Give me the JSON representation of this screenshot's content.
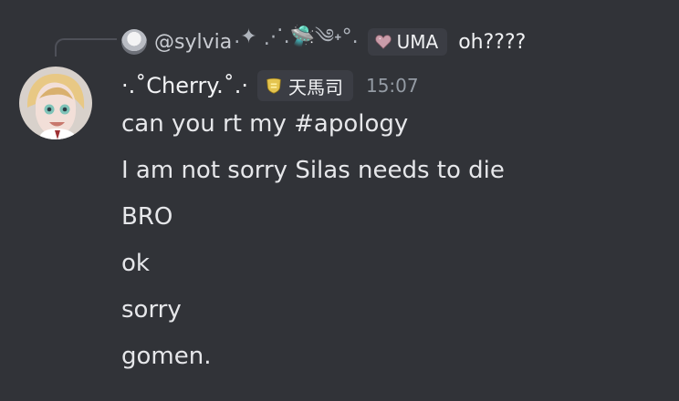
{
  "reply": {
    "author": "@sylvia",
    "author_deco": ".✦ ⋰.🛸༄˖°.",
    "tag": "UMA",
    "text": "oh????"
  },
  "message": {
    "author": "·.˚Cherry.˚.·",
    "tag": "天馬司",
    "time": "15:07",
    "lines": [
      "can you rt my #apology",
      "I am not sorry Silas needs to die",
      "BRO",
      "ok",
      "sorry",
      "gomen."
    ]
  },
  "icons": {
    "reply_avatar": "reply-avatar-icon",
    "heart": "heart-icon",
    "shield": "shield-icon"
  },
  "colors": {
    "background": "#313338",
    "text": "#e6e7ea",
    "muted": "#949ba4",
    "pill": "#3b3d44"
  }
}
